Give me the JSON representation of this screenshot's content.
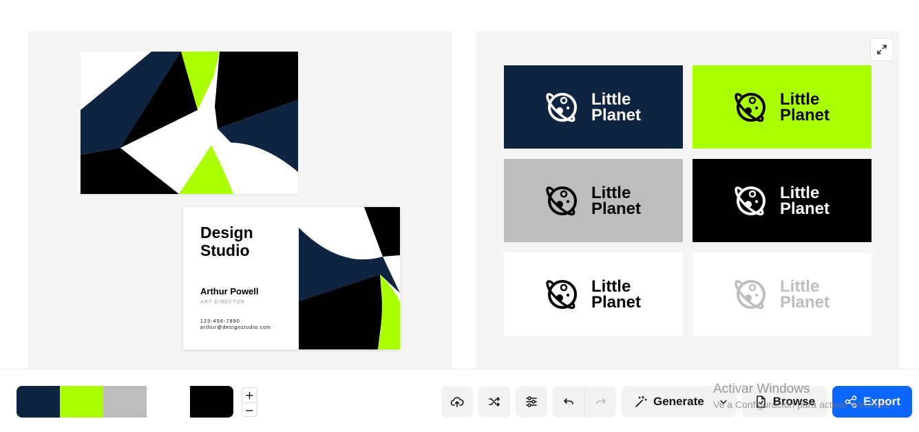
{
  "colors": {
    "navy": "#0f2440",
    "lime": "#aaff00",
    "gray": "#bdbdbd",
    "white": "#ffffff",
    "black": "#000000",
    "accent": "#0b66ff"
  },
  "business_card": {
    "title": "Design Studio",
    "name": "Arthur Powell",
    "role": "ART DIRECTOR",
    "phone": "123-456-7890",
    "email": "arthur@designstudio.com"
  },
  "logo": {
    "line1": "Little",
    "line2": "Planet",
    "icon": "planet-icon",
    "variants": [
      {
        "background": "#0f2440",
        "foreground": "#ffffff"
      },
      {
        "background": "#aaff00",
        "foreground": "#000000"
      },
      {
        "background": "#bdbdbd",
        "foreground": "#000000"
      },
      {
        "background": "#000000",
        "foreground": "#ffffff"
      },
      {
        "background": "#ffffff",
        "foreground": "#000000"
      },
      {
        "background": "#ffffff",
        "foreground": "#bdbdbd"
      }
    ]
  },
  "palette": [
    "#0f2440",
    "#aaff00",
    "#bdbdbd",
    "#ffffff",
    "#000000"
  ],
  "zoom": {
    "plus_label": "+",
    "minus_label": "−"
  },
  "toolbar": {
    "upload_icon": "cloud-upload-icon",
    "shuffle_icon": "shuffle-icon",
    "adjust_icon": "sliders-icon",
    "undo_icon": "undo-icon",
    "redo_icon": "redo-icon",
    "generate_label": "Generate",
    "browse_label": "Browse",
    "export_label": "Export"
  },
  "watermark": {
    "title": "Activar Windows",
    "subtitle": "Ve a Configuración para activar Windows."
  }
}
